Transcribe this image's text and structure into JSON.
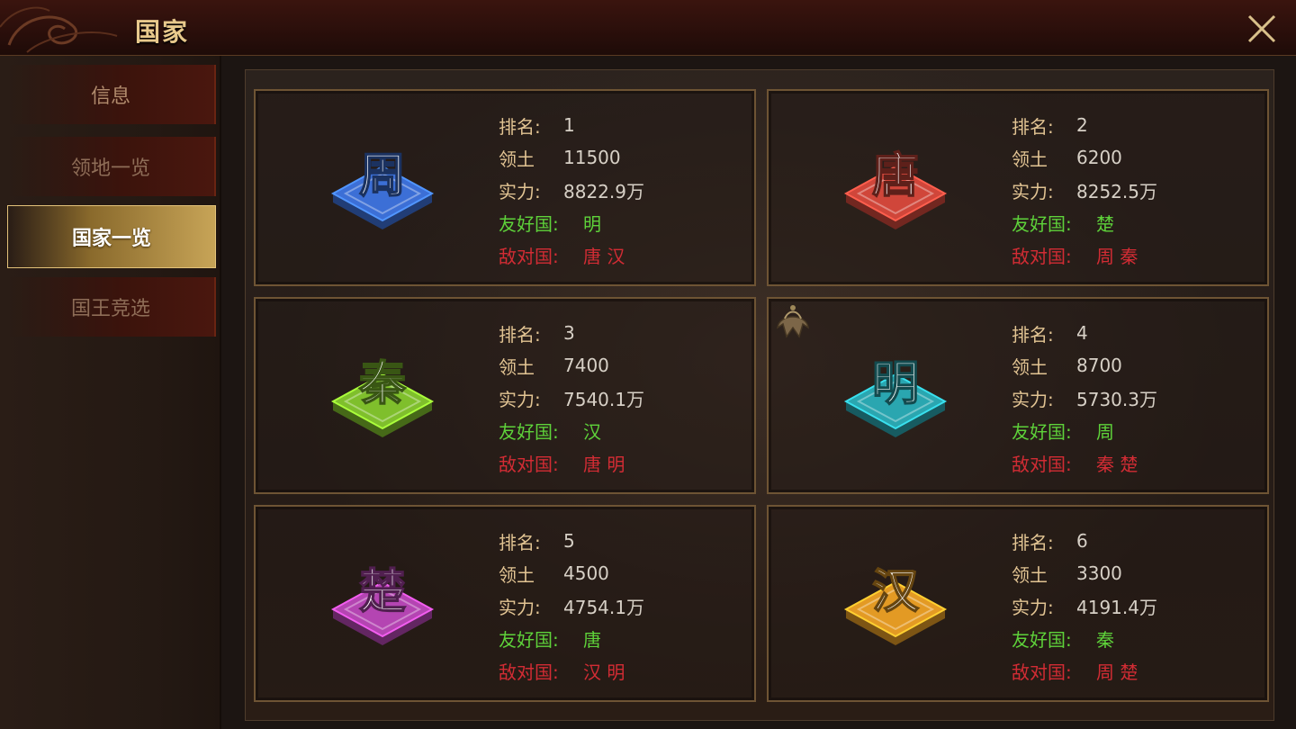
{
  "header": {
    "title": "国家"
  },
  "sidebar": {
    "items": [
      {
        "label": "信息"
      },
      {
        "label": "领地一览"
      },
      {
        "label": "国家一览"
      },
      {
        "label": "国王竞选"
      }
    ],
    "active_index": 2
  },
  "labels": {
    "rank": "排名:",
    "territory": "领土",
    "power": "实力:",
    "friendly": "友好国:",
    "enemy": "敌对国:"
  },
  "countries": [
    {
      "name": "周",
      "color": "#3c6fd6",
      "rank": "1",
      "territory": "11500",
      "power": "8822.9万",
      "friendly": "明",
      "enemy": "唐 汉"
    },
    {
      "name": "唐",
      "color": "#d0463a",
      "rank": "2",
      "territory": "6200",
      "power": "8252.5万",
      "friendly": "楚",
      "enemy": "周 秦"
    },
    {
      "name": "秦",
      "color": "#7fbf2c",
      "rank": "3",
      "territory": "7400",
      "power": "7540.1万",
      "friendly": "汉",
      "enemy": "唐 明"
    },
    {
      "name": "明",
      "color": "#2aa6b0",
      "rank": "4",
      "territory": "8700",
      "power": "5730.3万",
      "friendly": "周",
      "enemy": "秦 楚"
    },
    {
      "name": "楚",
      "color": "#b445b2",
      "rank": "5",
      "territory": "4500",
      "power": "4754.1万",
      "friendly": "唐",
      "enemy": "汉 明"
    },
    {
      "name": "汉",
      "color": "#e39a24",
      "rank": "6",
      "territory": "3300",
      "power": "4191.4万",
      "friendly": "秦",
      "enemy": "周 楚"
    }
  ]
}
